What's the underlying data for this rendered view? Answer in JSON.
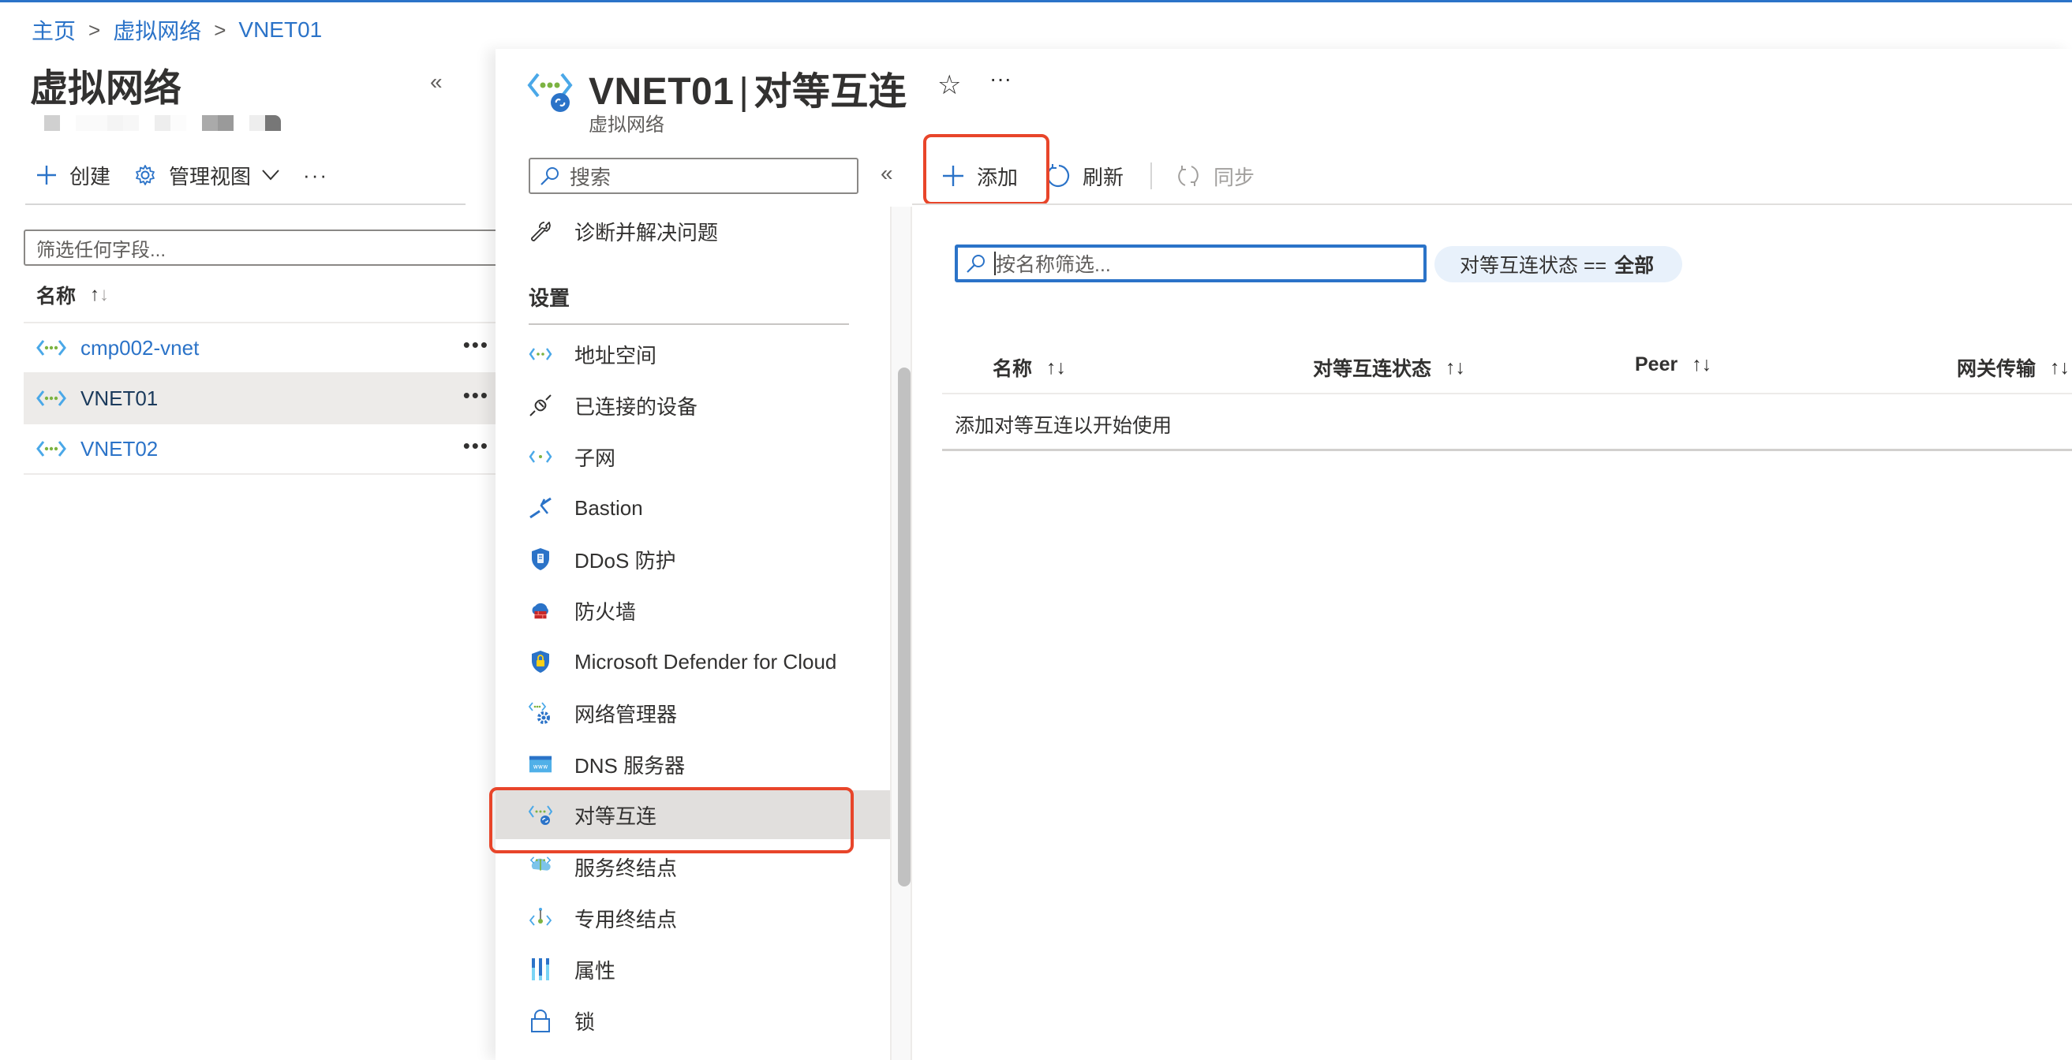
{
  "breadcrumb": [
    {
      "label": "主页"
    },
    {
      "label": "虚拟网络"
    },
    {
      "label": "VNET01"
    }
  ],
  "left_blade": {
    "title": "虚拟网络",
    "collapse_icon": "double-chevron-left",
    "toolbar": {
      "create_label": "创建",
      "manage_view_label": "管理视图",
      "more_label": "···"
    },
    "filter_placeholder": "筛选任何字段...",
    "column_name": "名称",
    "sort_up": "↑",
    "sort_down": "↓",
    "rows": [
      {
        "name": "cmp002-vnet",
        "selected": false,
        "more": "•••"
      },
      {
        "name": "VNET01",
        "selected": true,
        "more": "•••"
      },
      {
        "name": "VNET02",
        "selected": false,
        "more": "•••"
      }
    ]
  },
  "right_blade": {
    "title_resource": "VNET01",
    "title_separator": "|",
    "title_page": "对等互连",
    "subtitle": "虚拟网络",
    "star": "☆",
    "more": "···",
    "menu": {
      "search_placeholder": "搜索",
      "collapse": "«",
      "top_items": [
        {
          "label": "诊断并解决问题",
          "icon": "wrench-icon"
        }
      ],
      "section_label": "设置",
      "items": [
        {
          "label": "地址空间",
          "icon": "vnet-icon"
        },
        {
          "label": "已连接的设备",
          "icon": "plug-icon"
        },
        {
          "label": "子网",
          "icon": "subnet-icon"
        },
        {
          "label": "Bastion",
          "icon": "bastion-icon"
        },
        {
          "label": "DDoS 防护",
          "icon": "ddos-shield-icon"
        },
        {
          "label": "防火墙",
          "icon": "firewall-icon"
        },
        {
          "label": "Microsoft Defender for Cloud",
          "icon": "defender-shield-icon"
        },
        {
          "label": "网络管理器",
          "icon": "network-manager-icon"
        },
        {
          "label": "DNS 服务器",
          "icon": "dns-icon"
        },
        {
          "label": "对等互连",
          "icon": "peering-icon",
          "selected": true
        },
        {
          "label": "服务终结点",
          "icon": "service-endpoint-icon"
        },
        {
          "label": "专用终结点",
          "icon": "private-endpoint-icon"
        },
        {
          "label": "属性",
          "icon": "properties-icon"
        },
        {
          "label": "锁",
          "icon": "lock-icon"
        }
      ]
    },
    "commands": {
      "add": "添加",
      "refresh": "刷新",
      "sync": "同步"
    },
    "name_filter_placeholder": "按名称筛选...",
    "status_filter": {
      "label": "对等互连状态 ==",
      "value": "全部"
    },
    "table": {
      "columns": [
        {
          "label": "名称"
        },
        {
          "label": "对等互连状态"
        },
        {
          "label": "Peer"
        },
        {
          "label": "网关传输"
        }
      ],
      "sort_arrows": "↑↓",
      "empty_message": "添加对等互连以开始使用"
    }
  },
  "colors": {
    "accent": "#2b73c8",
    "highlight_box": "#e8452a",
    "selected_bg": "#e1dfdd",
    "pill_bg": "#e8f1fb"
  }
}
